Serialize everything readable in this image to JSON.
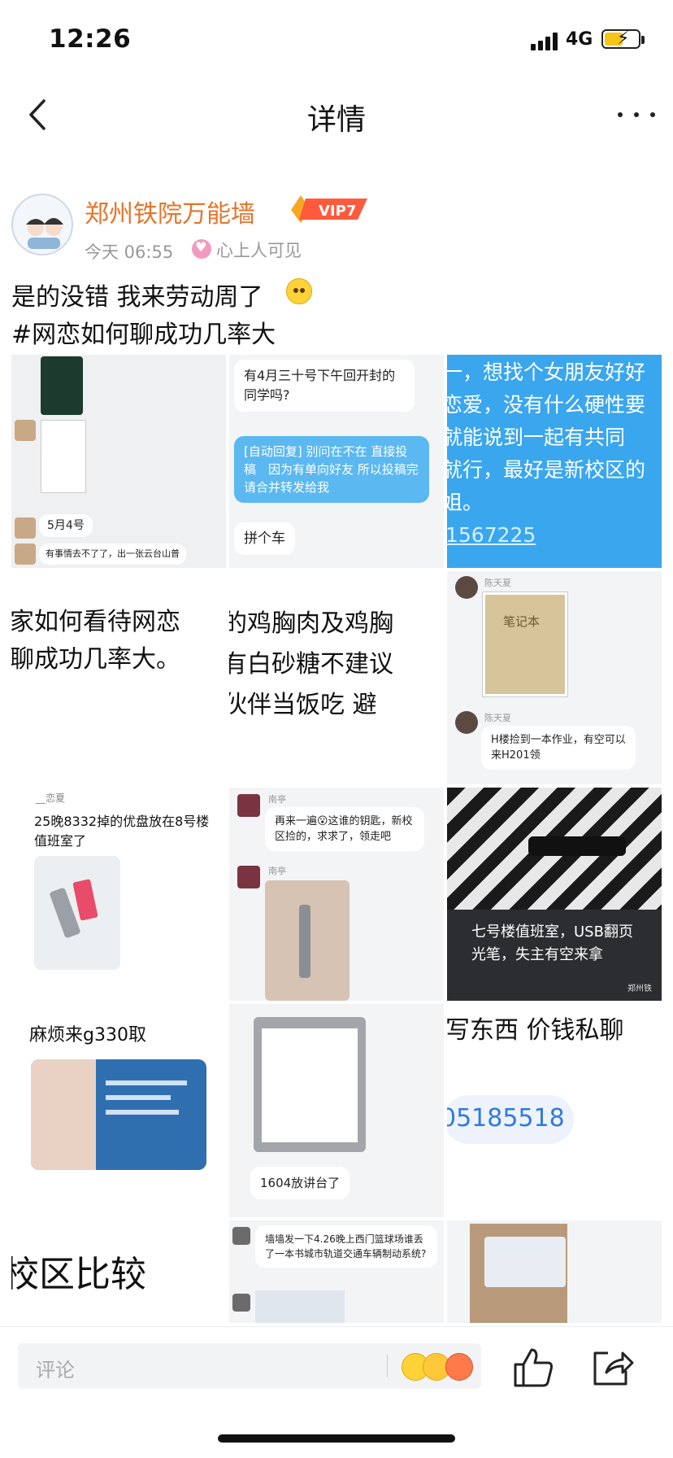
{
  "status": {
    "time": "12:26",
    "network": "4G"
  },
  "nav": {
    "title": "详情"
  },
  "author": {
    "name": "郑州铁院万能墙",
    "vip": "VIP7",
    "time": "今天 06:55",
    "visibility": "心上人可见"
  },
  "post": {
    "line1": "是的没错 我来劳动周了",
    "line2": "#网恋如何聊成功几率大"
  },
  "grid": {
    "c01": {
      "q": "有4月三十号下午回开封的同学吗?",
      "auto": "[自动回复] 别问在不在 直接投稿　因为有单向好友 所以投稿完请合并转发给我",
      "a": "拼个车"
    },
    "c00": {
      "date": "5月4号",
      "msg": "有事情去不了了，出一张云台山普"
    },
    "c02": {
      "text": "一，想找个女朋友好好\n恋爱，没有什么硬性要\n就能说到一起有共同\n就行，最好是新校区的\n姐。",
      "num": "1567225"
    },
    "c10": {
      "text": "家如何看待网恋\n聊成功几率大。"
    },
    "c11": {
      "text": "的鸡胸肉及鸡胸\n有白砂糖不建议\n伙伴当饭吃 避"
    },
    "c12": {
      "name1": "陈天夏",
      "notebook": "笔记本",
      "name2": "陈天夏",
      "msg": "H楼捡到一本作业，有空可以来H201领"
    },
    "c20": {
      "name": "__恋夏",
      "msg": "25晚8332掉的优盘放在8号楼值班室了"
    },
    "c21": {
      "name1": "南亭",
      "msg": "再来一遍😮这谁的钥匙，新校区捡的，求求了，领走吧",
      "name2": "南亭"
    },
    "c22": {
      "msg": "七号楼值班室，USB翻页\n光笔，失主有空来拿",
      "mark": "郑州铁"
    },
    "c30": {
      "msg": "麻烦来g330取"
    },
    "c31": {
      "msg": "1604放讲台了"
    },
    "c32": {
      "text": "写东西 价钱私聊",
      "num": "05185518"
    },
    "c40": {
      "text": "校区比较"
    },
    "c41": {
      "msg": "墙墙发一下4.26晚上西门篮球场谁丢了一本书城市轨道交通车辆制动系统?"
    }
  },
  "bottom": {
    "comment_placeholder": "评论"
  },
  "colors": {
    "accent": "#e5742a",
    "blue": "#3aa6ee"
  },
  "icons": [
    "back-icon",
    "more-icon",
    "heart-icon",
    "like-icon",
    "share-icon",
    "emoji-icon"
  ]
}
